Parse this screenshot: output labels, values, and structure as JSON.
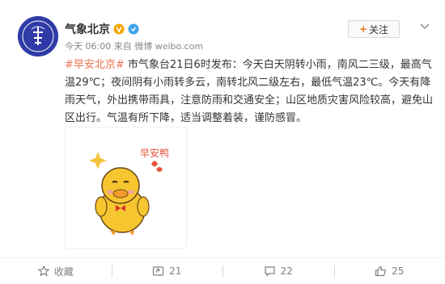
{
  "post": {
    "username": "气象北京",
    "follow_label": "关注",
    "time": "今天 06:00",
    "source_prefix": "来自",
    "source": "微博 weibo.com",
    "topic": "#早安北京#",
    "text": " 市气象台21日6时发布：今天白天阴转小雨，南风二三级，最高气温29℃；夜间阴有小雨转多云，南转北风二级左右，最低气温23℃。今天有降雨天气，外出携带雨具，注意防雨和交通安全；山区地质灾害风险较高，避免山区出行。气温有所下降，适当调整着装，谨防感冒。",
    "image_caption": "早安鸭"
  },
  "actions": {
    "favorite_label": "收藏",
    "repost_count": "21",
    "comment_count": "22",
    "like_count": "25"
  },
  "colors": {
    "topic": "#eb7350",
    "verified": "#f7a600",
    "accent": "#e07a17"
  }
}
